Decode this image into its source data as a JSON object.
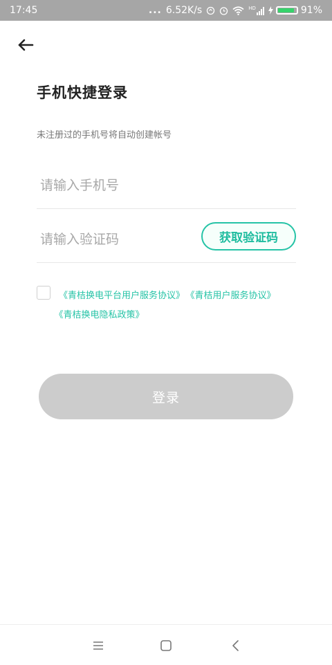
{
  "status_bar": {
    "time": "17:45",
    "dots": "...",
    "speed": "6.52K/s",
    "network": "HD",
    "battery_level_percent": 91,
    "battery_text": "91%"
  },
  "header": {
    "back_icon": "back-arrow-icon",
    "title": "手机快捷登录",
    "subtitle": "未注册过的手机号将自动创建帐号"
  },
  "form": {
    "phone_placeholder": "请输入手机号",
    "phone_value": "",
    "code_placeholder": "请输入验证码",
    "code_value": "",
    "get_code_label": "获取验证码"
  },
  "agreement": {
    "checked": false,
    "links": [
      "《青桔换电平台用户服务协议》",
      "《青桔用户服务协议》",
      "《青桔换电隐私政策》"
    ]
  },
  "login": {
    "label": "登录"
  },
  "colors": {
    "accent": "#25c3a6",
    "status_bar_bg": "#a6a6a6",
    "login_disabled_bg": "#cccccc",
    "battery": "#36d36b"
  },
  "navbar": {
    "icons": [
      "menu-icon",
      "home-icon",
      "back-icon"
    ]
  }
}
